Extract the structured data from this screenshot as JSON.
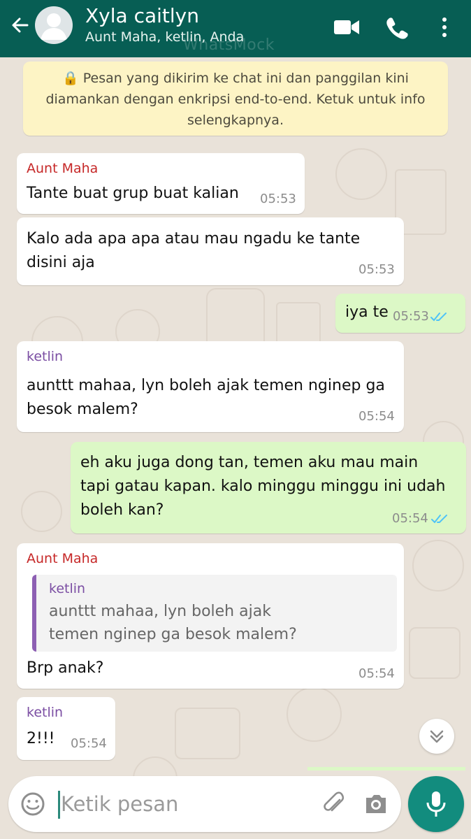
{
  "header": {
    "title": "Xyla caitlyn",
    "subtitle": "Aunt Maha, ketlin, Anda",
    "watermark": "WhatsMock",
    "icons": [
      "back-arrow-icon",
      "avatar-icon",
      "video-call-icon",
      "phone-icon",
      "more-icon"
    ]
  },
  "notice": {
    "text": "🔒 Pesan yang dikirim ke chat ini dan panggilan kini diamankan dengan enkripsi end-to-end. Ketuk untuk info selengkapnya."
  },
  "messages": [
    {
      "sender": "Aunt Maha",
      "text": "Tante buat grup buat kalian",
      "time": "05:53"
    },
    {
      "text": "Kalo ada apa apa atau mau ngadu ke tante\ndisini aja",
      "time": "05:53"
    },
    {
      "text": "iya te",
      "time": "05:53"
    },
    {
      "sender": "ketlin",
      "text": "aunttt mahaa, lyn boleh ajak temen nginep ga\nbesok malem?",
      "time": "05:54"
    },
    {
      "text": "eh aku juga dong tan, temen aku mau main\ntapi gatau kapan. kalo minggu minggu ini udah\nboleh kan?",
      "time": "05:54"
    },
    {
      "sender": "Aunt Maha",
      "quote": {
        "sender": "ketlin",
        "text": "aunttt mahaa, lyn boleh ajak\ntemen nginep ga besok malem?"
      },
      "text": "Brp anak?",
      "time": "05:54"
    },
    {
      "sender": "ketlin",
      "text": "2!!!",
      "time": "05:54"
    }
  ],
  "colors": {
    "header": "#075e54",
    "incoming": "#ffffff",
    "outgoing": "#dcf8c6",
    "aunt_maha": "#c62828",
    "ketlin": "#7b4ea3",
    "read_ticks": "#4fc3f7",
    "mic_button": "#128c7e"
  },
  "composer": {
    "placeholder": "Ketik pesan",
    "icons": [
      "emoji-icon",
      "attach-icon",
      "camera-icon",
      "mic-icon"
    ]
  }
}
